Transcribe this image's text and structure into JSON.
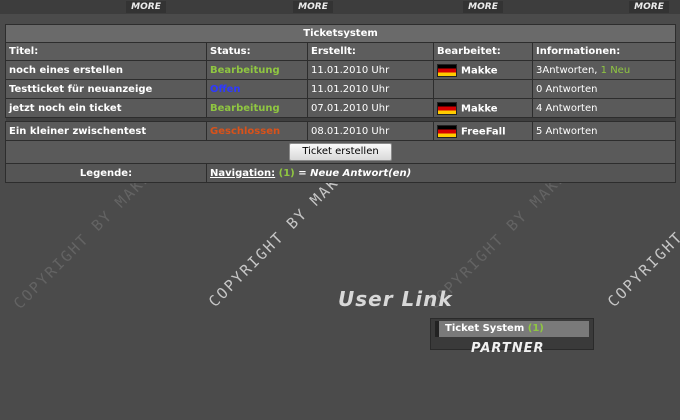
{
  "top_bar": {
    "more_label": "MORE"
  },
  "ticket_panel": {
    "title": "Ticketsystem",
    "columns": [
      "Titel:",
      "Status:",
      "Erstellt:",
      "Bearbeitet:",
      "Informationen:"
    ],
    "rows": [
      {
        "title": "noch eines erstellen",
        "status": "Bearbeitung",
        "created": "11.01.2010 Uhr",
        "edited_by": "Makke",
        "info": "3Antworten,",
        "info_new": "1 Neu"
      },
      {
        "title": "Testticket für neuanzeige",
        "status": "Offen",
        "created": "11.01.2010 Uhr",
        "edited_by": "",
        "info": "0 Antworten",
        "info_new": ""
      },
      {
        "title": "jetzt noch ein ticket",
        "status": "Bearbeitung",
        "created": "07.01.2010 Uhr",
        "edited_by": "Makke",
        "info": "4 Antworten",
        "info_new": ""
      },
      {
        "title": "Ein kleiner zwischentest",
        "status": "Geschlossen",
        "created": "08.01.2010 Uhr",
        "edited_by": "FreeFall",
        "info": "5 Antworten",
        "info_new": ""
      }
    ],
    "create_button": "Ticket erstellen",
    "legend_label": "Legende:",
    "legend_nav": "Navigation:",
    "legend_count": "(1)",
    "legend_text": "= Neue Antwort(en)"
  },
  "watermark": "COPYRIGHT BY MAKKE",
  "user_link": {
    "title": "User Link",
    "item": "Ticket System",
    "item_count": "(1)",
    "partner": "PARTNER"
  },
  "colors": {
    "background": "#4b4b4b",
    "status_green": "#8fc641",
    "status_blue": "#2e39ff",
    "status_red": "#d9521a"
  }
}
